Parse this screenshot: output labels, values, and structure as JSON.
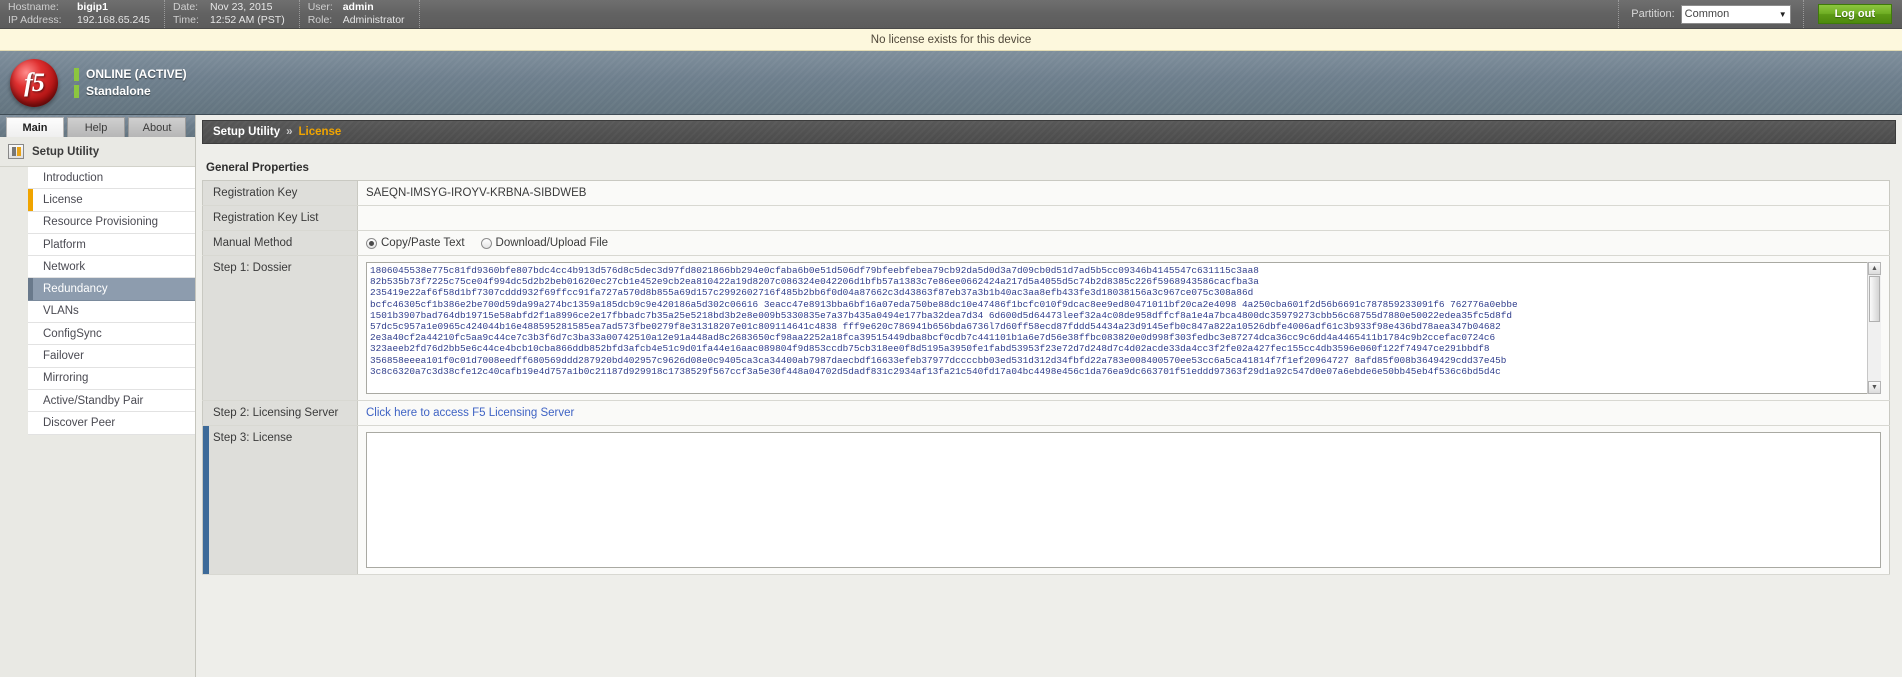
{
  "topbar": {
    "hostname_label": "Hostname:",
    "hostname_value": "bigip1",
    "ip_label": "IP Address:",
    "ip_value": "192.168.65.245",
    "date_label": "Date:",
    "date_value": "Nov 23, 2015",
    "time_label": "Time:",
    "time_value": "12:52 AM (PST)",
    "user_label": "User:",
    "user_value": "admin",
    "role_label": "Role:",
    "role_value": "Administrator",
    "partition_label": "Partition:",
    "partition_value": "Common",
    "partition_options": [
      "Common"
    ],
    "logout_label": "Log out"
  },
  "notice": {
    "text": "No license exists for this device"
  },
  "brand": {
    "logo_text": "f5",
    "status_primary": "ONLINE (ACTIVE)",
    "status_secondary": "Standalone",
    "status_color": "#8cc63f"
  },
  "nav": {
    "tabs": [
      {
        "label": "Main",
        "active": true
      },
      {
        "label": "Help",
        "active": false
      },
      {
        "label": "About",
        "active": false
      }
    ],
    "module_title": "Setup Utility",
    "items": [
      {
        "label": "Introduction",
        "state": "normal"
      },
      {
        "label": "License",
        "state": "marked"
      },
      {
        "label": "Resource Provisioning",
        "state": "normal"
      },
      {
        "label": "Platform",
        "state": "normal"
      },
      {
        "label": "Network",
        "state": "normal"
      },
      {
        "label": "Redundancy",
        "state": "selected"
      },
      {
        "label": "VLANs",
        "state": "normal"
      },
      {
        "label": "ConfigSync",
        "state": "normal"
      },
      {
        "label": "Failover",
        "state": "normal"
      },
      {
        "label": "Mirroring",
        "state": "normal"
      },
      {
        "label": "Active/Standby Pair",
        "state": "normal"
      },
      {
        "label": "Discover Peer",
        "state": "normal"
      }
    ]
  },
  "breadcrumb": {
    "root": "Setup Utility",
    "separator": "»",
    "current": "License"
  },
  "main": {
    "section_title": "General Properties",
    "rows": {
      "registration_key_label": "Registration Key",
      "registration_key_value": "SAEQN-IMSYG-IROYV-KRBNA-SIBDWEB",
      "registration_key_list_label": "Registration Key List",
      "registration_key_list_value": "",
      "manual_method_label": "Manual Method",
      "manual_method_option_1": "Copy/Paste Text",
      "manual_method_option_2": "Download/Upload File",
      "manual_method_selected": "Copy/Paste Text",
      "step1_label": "Step 1: Dossier",
      "step1_value": "1806045538e775c81fd9360bfe807bdc4cc4b913d576d8c5dec3d97fd8021866bb294e0cfaba6b0e51d506df79bfeebfebea79cb92da5d0d3a7d09cb0d51d7ad5b5cc09346b4145547c631115c3aa8\n82b535b73f7225c75ce04f994dc5d2b2beb01620ec27cb1e452e9cb2ea810422a19d8207c086324e042206d1bfb57a1383c7e86ee0662424a217d5a4055d5c74b2d8385c226f5968943586cacfba3a\n235419e22af6f58d1bf7307cddd932f69ffcc91fa727a570d8b855a69d157c2992602716f485b2bb6f0d04a87662c3d43863f87eb37a3b1b40ac3aa8efb433fe3d18038156a3c967ce075c308a86d\nbcfc46305cf1b386e2be700d59da99a274bc1359a185dcb9c9e420186a5d302c06616 3eacc47e8913bba6bf16a07eda750be88dc10e47486f1bcfc010f9dcac8ee9ed80471011bf20ca2e4098 4a250cba601f2d56b6691c787859233091f6 762776a0ebbe\n1501b3907bad764db19715e58abfd2f1a8996ce2e17fbbadc7b35a25e5218bd3b2e8e009b5330835e7a37b435a0494e177ba32dea7d34 6d600d5d64473leef32a4c08de958dffcf8a1e4a7bca4800dc35979273cbb56c68755d7880e50022edea35fc5d8fd\n57dc5c957a1e0965c424044b16e488595281585ea7ad573fbe0279f8e31318207e01c809114641c4838 fff9e620c786941b656bda6736l7d60ff58ecd87fddd54434a23d9145efb0c847a822a10526dbfe4006adf61c3b933f98e436bd78aea347b04682\n2e3a40cf2a44210fc5aa9c44ce7c3b3f6d7c3ba33a00742510a12e91a448ad8c2683650cf98aa2252a18fca39515449dba8bcf0cdb7c441101b1a6e7d56e38ffbc083820e0d998f303fedbc3e87274dca36cc9c6dd4a4465411b1784c9b2ccefac0724c6\n323aeeb2fd76d2bb5e6c44ce4bcb10cba866ddb852bfd3afcb4e51c9d01fa44e16aac089804f9d853ccdb75cb318ee0f8d5195a3950fe1fabd53953f23e72d7d248d7c4d02acde33da4cc3f2fe02a427fec155cc4db3596e060f122f74947ce291bbdf8\n356858eeea101f0c01d7008eedff680569ddd287920bd402957c9626d08e0c9405ca3ca34400ab7987daecbdf16633efeb37977dccccbb03ed531d312d34fbfd22a783e008400570ee53cc6a5ca41814f7f1ef20964727 8afd85f008b3649429cdd37e45b\n3c8c6320a7c3d38cfe12c40cafb19e4d757a1b0c21187d929918c1738529f567ccf3a5e30f448a04702d5dadf831c2934af13fa21c540fd17a04bc4498e456c1da76ea9dc663701f51eddd97363f29d1a92c547d0e07a6ebde6e50bb45eb4f536c6bd5d4c",
      "step2_label": "Step 2: Licensing Server",
      "step2_link": "Click here to access F5 Licensing Server",
      "step3_label": "Step 3: License",
      "step3_value": ""
    }
  },
  "icons": {
    "module": "setup-utility-icon",
    "dropdown": "chevron-down-icon",
    "scroll_up": "▲",
    "scroll_down": "▼"
  }
}
